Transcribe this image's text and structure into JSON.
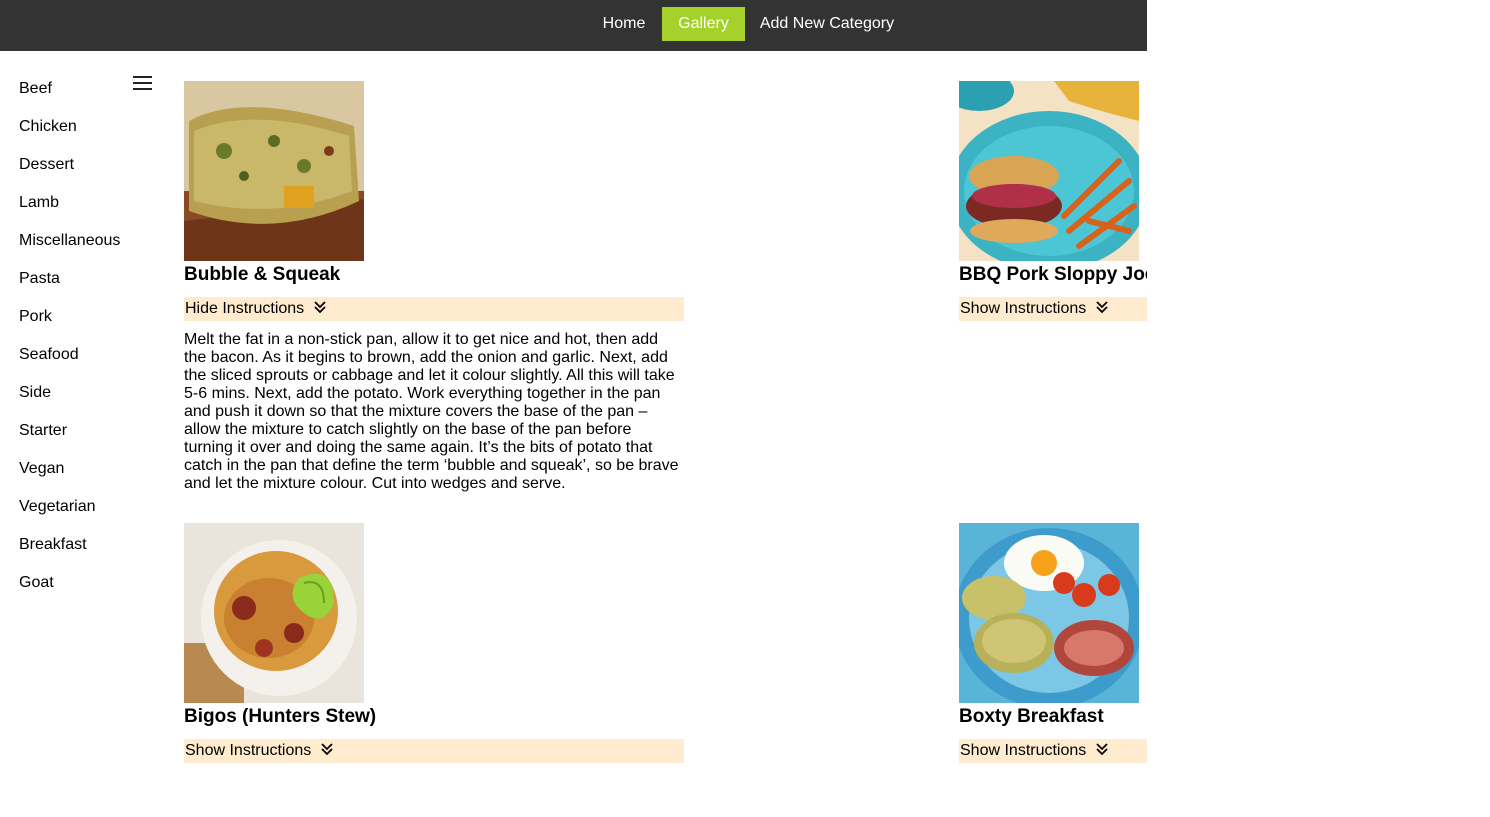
{
  "nav": {
    "home": "Home",
    "gallery": "Gallery",
    "add_category": "Add New Category",
    "active_color": "#a4d12a",
    "bar_color": "#333333"
  },
  "sidebar": {
    "menu_icon": "hamburger-menu-icon",
    "items": [
      {
        "label": "Beef"
      },
      {
        "label": "Chicken"
      },
      {
        "label": "Dessert"
      },
      {
        "label": "Lamb"
      },
      {
        "label": "Miscellaneous"
      },
      {
        "label": "Pasta"
      },
      {
        "label": "Pork"
      },
      {
        "label": "Seafood"
      },
      {
        "label": "Side"
      },
      {
        "label": "Starter"
      },
      {
        "label": "Vegan"
      },
      {
        "label": "Vegetarian"
      },
      {
        "label": "Breakfast"
      },
      {
        "label": "Goat"
      }
    ]
  },
  "recipes": [
    {
      "title": "Bubble & Squeak",
      "toggle_label": "Hide Instructions",
      "expanded": true,
      "instructions": "Melt the fat in a non-stick pan, allow it to get nice and hot, then add the bacon. As it begins to brown, add the onion and garlic. Next, add the sliced sprouts or cabbage and let it colour slightly. All this will take 5-6 mins. Next, add the potato. Work everything together in the pan and push it down so that the mixture covers the base of the pan – allow the mixture to catch slightly on the base of the pan before turning it over and doing the same again. It’s the bits of potato that catch in the pan that define the term ‘bubble and squeak’, so be brave and let the mixture colour. Cut into wedges and serve."
    },
    {
      "title": "BBQ Pork Sloppy Joes",
      "toggle_label": "Show Instructions",
      "expanded": false
    },
    {
      "title": "Bigos (Hunters Stew)",
      "toggle_label": "Show Instructions",
      "expanded": false
    },
    {
      "title": "Boxty Breakfast",
      "toggle_label": "Show Instructions",
      "expanded": false
    }
  ],
  "colors": {
    "instruction_bar": "#ffebcd"
  },
  "icons": {
    "toggle": "double-chevron-down-icon"
  }
}
